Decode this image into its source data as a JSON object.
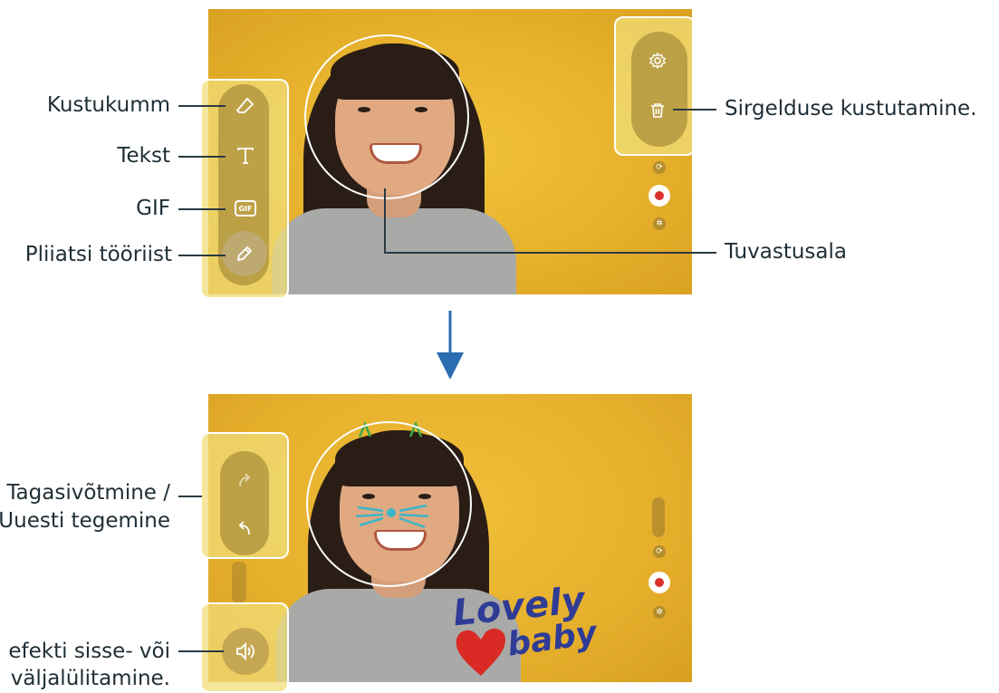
{
  "labels": {
    "eraser": "Kustukumm",
    "text": "Tekst",
    "gif": "GIF",
    "pen": "Pliiatsi tööriist",
    "delete": "Sirgelduse kustutamine.",
    "detection": "Tuvastusala",
    "undo_redo_line1": "Tagasivõtmine /",
    "undo_redo_line2": "Uuesti tegemine",
    "sound_line1": "efekti sisse- või",
    "sound_line2": "väljalülitamine."
  },
  "tools": {
    "gif_badge": "GIF"
  },
  "doodle": {
    "line1": "Lovely",
    "line2": "baby"
  },
  "colors": {
    "background": "#e7b22d",
    "record": "#d8302b",
    "arrow": "#2a6db0",
    "doodle_text": "#2f3c96",
    "heart": "#d92a26"
  }
}
